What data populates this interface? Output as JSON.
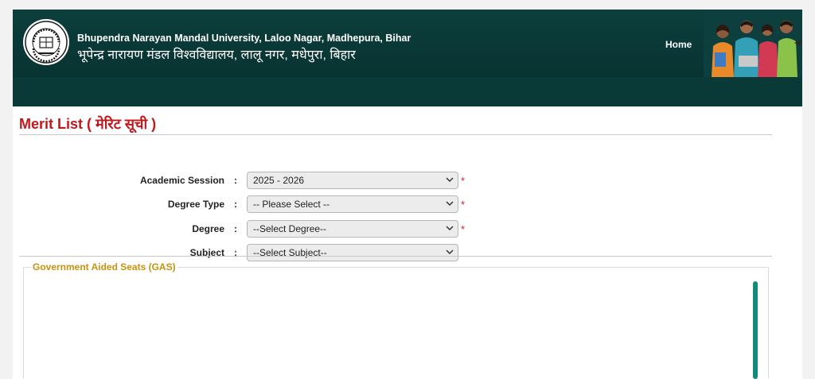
{
  "header": {
    "university_en": "Bhupendra Narayan Mandal University, Laloo Nagar, Madhepura, Bihar",
    "university_hi": "भूपेन्द्र नारायण मंडल विश्वविद्यालय, लालू नगर, मधेपुरा, बिहार",
    "nav_home": "Home"
  },
  "page": {
    "title": "Merit List ( मेरिट सूची )"
  },
  "form": {
    "colon": ":",
    "required_mark": "*",
    "academic_session": {
      "label": "Academic Session",
      "value": "2025 - 2026",
      "required": true
    },
    "degree_type": {
      "label": "Degree Type",
      "value": "-- Please Select --",
      "required": true
    },
    "degree": {
      "label": "Degree",
      "value": "--Select Degree--",
      "required": true
    },
    "subject": {
      "label": "Subject",
      "value": "--Select Subject--",
      "required": false
    }
  },
  "section": {
    "legend": "Government Aided Seats (GAS)"
  },
  "colors": {
    "header_bg": "#0c3f3d",
    "title_red": "#c0181b",
    "legend_gold": "#c9920f",
    "required_red": "#d2232a",
    "scrollbar_teal": "#14897d"
  },
  "icons": {
    "logo": "university-seal-icon",
    "dropdown": "chevron-down-icon"
  }
}
